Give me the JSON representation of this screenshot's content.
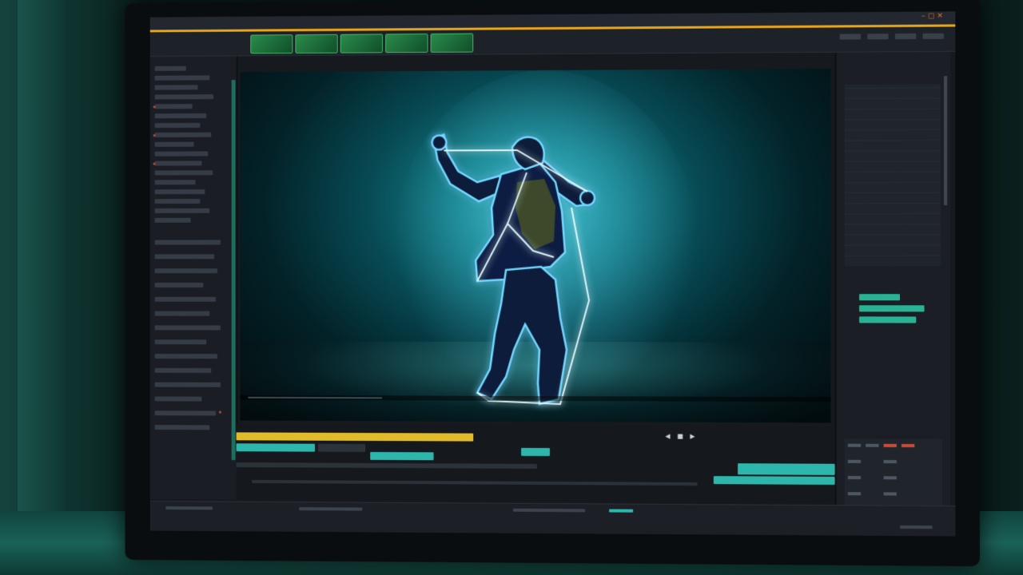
{
  "scene": {
    "description_visible_text": ""
  },
  "app": {
    "title": "",
    "window_controls": "– ▢ ✕",
    "menu_items": [
      "",
      "",
      "",
      ""
    ]
  },
  "viewer": {
    "playback_controls": "◀ ■ ▶"
  },
  "colors": {
    "accent_bar": "#e8a517",
    "track_yellow": "#e2bb2b",
    "track_teal": "#2db6ac",
    "glow_outline": "#62c8ff"
  },
  "icons": [
    "play-icon",
    "stop-icon",
    "rewind-icon",
    "settings-icon"
  ]
}
